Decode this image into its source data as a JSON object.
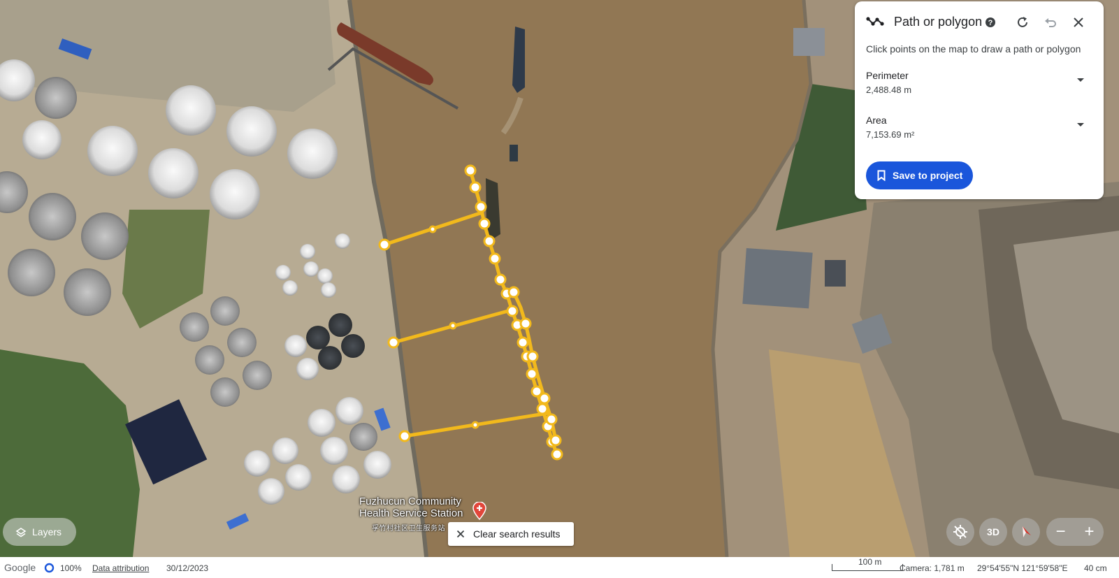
{
  "map": {
    "place": {
      "name_line1": "Fuzhucun Community",
      "name_line2": "Health Service Station",
      "name_local": "孚竹村社区卫生服务站"
    },
    "icons": {
      "pin": "location-pin-icon"
    }
  },
  "measure_panel": {
    "title": "Path or polygon",
    "hint": "Click points on the map to draw a path or polygon",
    "perimeter_label": "Perimeter",
    "perimeter_value": "2,488.48 m",
    "area_label": "Area",
    "area_value": "7,153.69 m²",
    "save_label": "Save to project",
    "icons": [
      "path-icon",
      "help-icon",
      "redo-icon",
      "undo-icon",
      "close-icon",
      "bookmark-icon"
    ]
  },
  "controls": {
    "layers_label": "Layers",
    "clear_search_label": "Clear search results",
    "three_d_label": "3D",
    "zoom_out": "−",
    "zoom_in": "+"
  },
  "status_bar": {
    "brand": "Google",
    "load_percent": "100%",
    "data_attribution": "Data attribution",
    "imagery_date": "30/12/2023",
    "scale_label": "100 m",
    "camera": "Camera: 1,781 m",
    "coordinates": "29°54'55\"N 121°59'58\"E",
    "elevation": "40 cm"
  },
  "colors": {
    "river": "#8f7650",
    "accent_blue": "#1a56db",
    "measure_line": "#f2b91c"
  }
}
